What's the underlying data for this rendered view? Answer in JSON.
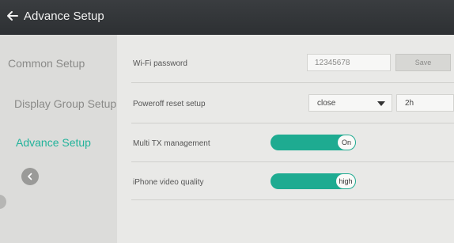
{
  "header": {
    "title": "Advance Setup"
  },
  "sidebar": {
    "items": [
      {
        "label": "Common Setup",
        "active": false
      },
      {
        "label": "Display Group Setup",
        "active": false
      },
      {
        "label": "Advance Setup",
        "active": true
      }
    ]
  },
  "settings": {
    "wifi": {
      "label": "Wi-Fi password",
      "value": "12345678",
      "save_label": "Save"
    },
    "poweroff": {
      "label": "Poweroff reset setup",
      "mode": "close",
      "duration": "2h"
    },
    "multi_tx": {
      "label": "Multi TX management",
      "state": "On"
    },
    "iphone_quality": {
      "label": "iPhone video quality",
      "state": "high"
    }
  },
  "colors": {
    "accent": "#22b39b",
    "toggle": "#1eab91",
    "header": "#2f3235"
  }
}
